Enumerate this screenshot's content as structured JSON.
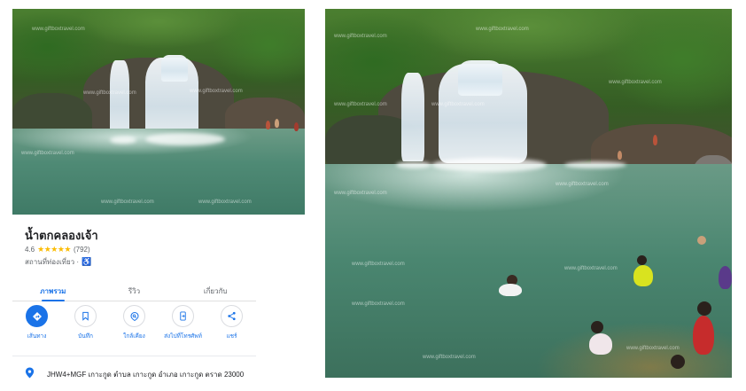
{
  "place": {
    "title": "น้ำตกคลองเจ้า",
    "rating": "4.6",
    "stars": "★★★★★",
    "review_count": "(792)",
    "category": "สถานที่ท่องเที่ยว ·",
    "accessibility_icon": "wheelchair-icon"
  },
  "tabs": [
    {
      "label": "ภาพรวม",
      "active": true
    },
    {
      "label": "รีวิว",
      "active": false
    },
    {
      "label": "เกี่ยวกับ",
      "active": false
    }
  ],
  "actions": [
    {
      "label": "เส้นทาง",
      "icon": "directions-icon"
    },
    {
      "label": "บันทึก",
      "icon": "bookmark-icon"
    },
    {
      "label": "ใกล้เคียง",
      "icon": "nearby-icon"
    },
    {
      "label": "ส่งไปที่โทรศัพท์",
      "icon": "phone-icon"
    },
    {
      "label": "แชร์",
      "icon": "share-icon"
    }
  ],
  "address": "JHW4+MGF เกาะกูด ตำบล เกาะกูด อำเภอ เกาะกูด ตราด 23000",
  "watermark": "www.giftboxtravel.com",
  "colors": {
    "accent": "#1a73e8",
    "star": "#fbbc04"
  }
}
